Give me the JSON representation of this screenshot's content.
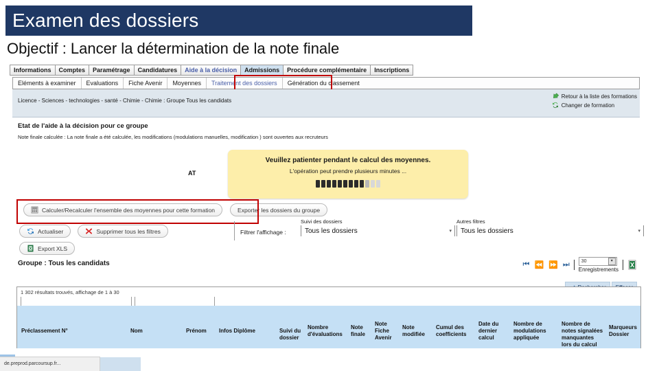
{
  "slide": {
    "title": "Examen des dossiers",
    "subtitle": "Objectif : Lancer la détermination de la note finale"
  },
  "app": {
    "primary_tabs": [
      {
        "label": "Informations",
        "state": "normal"
      },
      {
        "label": "Comptes",
        "state": "normal"
      },
      {
        "label": "Paramétrage",
        "state": "normal"
      },
      {
        "label": "Candidatures",
        "state": "normal"
      },
      {
        "label": "Aide à la décision",
        "state": "link"
      },
      {
        "label": "Admissions",
        "state": "active"
      },
      {
        "label": "Procédure complémentaire",
        "state": "normal"
      },
      {
        "label": "Inscriptions",
        "state": "normal"
      }
    ],
    "secondary_tabs": [
      {
        "label": "Eléments à examiner",
        "state": "normal"
      },
      {
        "label": "Evaluations",
        "state": "normal"
      },
      {
        "label": "Fiche Avenir",
        "state": "normal"
      },
      {
        "label": "Moyennes",
        "state": "normal"
      },
      {
        "label": "Traitement des dossiers",
        "state": "selected"
      },
      {
        "label": "Génération du classement",
        "state": "normal"
      }
    ],
    "breadcrumb": "Licence - Sciences - technologies - santé - Chimie - Chimie : Groupe Tous les candidats",
    "right_links": [
      {
        "label": "Retour à la liste des formations",
        "icon": "back-arrow-icon"
      },
      {
        "label": "Changer de formation",
        "icon": "refresh-icon"
      }
    ],
    "state_section": {
      "heading": "Etat de l'aide à la décision pour ce groupe",
      "text": "Note finale calculée : La note finale a été calculée, les modifications (modulations manuelles, modification ) sont ouvertes aux recruteurs",
      "partial_text": "AT"
    },
    "popup": {
      "line1": "Veuillez patienter pendant le calcul des moyennes.",
      "line2": "L'opération peut prendre plusieurs minutes ...",
      "progress_total": 12,
      "progress_filled": 9
    },
    "buttons": {
      "calculate": "Calculer/Recalculer l'ensemble des moyennes pour cette formation",
      "export_group": "Exporter les dossiers du groupe",
      "refresh": "Actualiser",
      "clear_filters": "Supprimer tous les filtres",
      "export_xls": "Export XLS"
    },
    "filters": {
      "label": "Filtrer l'affichage :",
      "suivi": {
        "caption": "Suivi des dossiers",
        "value": "Tous les dossiers"
      },
      "autres": {
        "caption": "Autres filtres",
        "value": "Tous les dossiers"
      }
    },
    "group_title": "Groupe : Tous les candidats",
    "pager": {
      "first": "first-page-icon",
      "prev": "prev-page-icon",
      "next": "next-page-icon",
      "last": "last-page-icon",
      "records_value": "30",
      "records_label": "Enregistrements",
      "excel_icon": "excel-export-icon"
    },
    "search_buttons": [
      {
        "label": "Rechercher",
        "icon": "search-icon"
      },
      {
        "label": "Effacer",
        "icon": "clear-icon"
      }
    ],
    "results_text": "1 302 résultats trouvés, affichage de 1 à 30",
    "table_headers": [
      "Préclassement N°",
      "Nom",
      "Prénom",
      "Infos Diplôme",
      "Suivi du dossier",
      "Nombre d'évaluations",
      "Note finale",
      "Note Fiche Avenir",
      "Note modifiée",
      "Cumul des coefficients",
      "Date du dernier calcul",
      "Nombre de modulations appliquée",
      "Nombre de notes signalées manquantes lors du calcul",
      "Marqueurs Dossier"
    ],
    "taskbar": {
      "label": "de.preprod.parcoursup.fr..."
    }
  },
  "colors": {
    "title_bg": "#1F3864",
    "highlight_red": "#C00000",
    "popup_bg": "#fdeeaa",
    "table_header_bg": "#c5e0f5",
    "breadcrumb_bg": "#dfe7ee"
  }
}
